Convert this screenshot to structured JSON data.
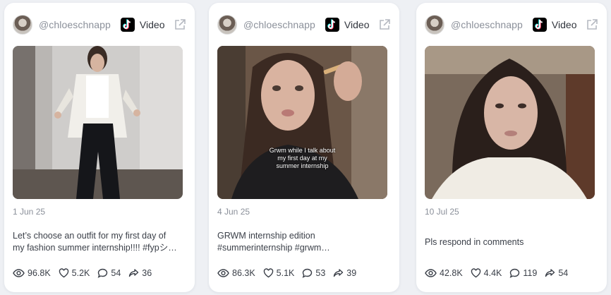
{
  "posts": [
    {
      "handle": "@chloeschnapp",
      "type_label": "Video",
      "date": "1 Jun 25",
      "desc_lines": [
        "Let’s choose an outfit for my first day of",
        "my fashion summer internship!!!! #fypシ…"
      ],
      "stats": {
        "views": "96.8K",
        "likes": "5.2K",
        "comments": "54",
        "shares": "36"
      },
      "overlay_lines": [
        "",
        "",
        ""
      ]
    },
    {
      "handle": "@chloeschnapp",
      "type_label": "Video",
      "date": "4 Jun 25",
      "desc_lines": [
        "GRWM internship edition",
        "#summerinternship #grwm…"
      ],
      "stats": {
        "views": "86.3K",
        "likes": "5.1K",
        "comments": "53",
        "shares": "39"
      },
      "overlay_lines": [
        "Grwm while I talk about",
        "my first day at my",
        "summer internship"
      ]
    },
    {
      "handle": "@chloeschnapp",
      "type_label": "Video",
      "date": "10 Jul 25",
      "desc_lines": [
        "Pls respond in comments",
        ""
      ],
      "stats": {
        "views": "42.8K",
        "likes": "4.4K",
        "comments": "119",
        "shares": "54"
      },
      "overlay_lines": [
        "",
        "",
        ""
      ]
    }
  ],
  "icons": {
    "platform": "tiktok-icon",
    "external": "external-link-icon",
    "views": "eye-icon",
    "likes": "heart-icon",
    "comments": "comment-icon",
    "shares": "share-icon"
  }
}
